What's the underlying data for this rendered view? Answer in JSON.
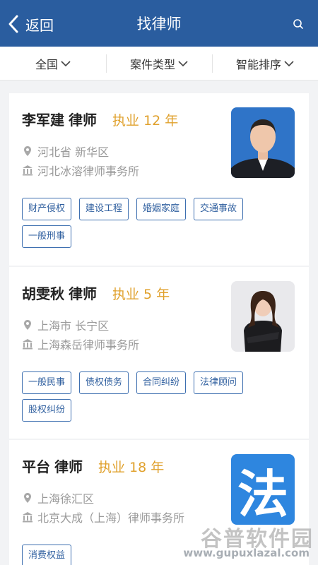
{
  "header": {
    "back_label": "返回",
    "title": "找律师",
    "search_icon": "search-icon"
  },
  "filters": [
    {
      "label": "全国"
    },
    {
      "label": "案件类型"
    },
    {
      "label": "智能排序"
    }
  ],
  "lawyers": [
    {
      "name": "李军建",
      "title": "律师",
      "years": "执业 12 年",
      "location": "河北省 新华区",
      "firm": "河北冰溶律师事务所",
      "tags": [
        "财产侵权",
        "建设工程",
        "婚姻家庭",
        "交通事故",
        "一般刑事"
      ]
    },
    {
      "name": "胡雯秋",
      "title": "律师",
      "years": "执业 5 年",
      "location": "上海市 长宁区",
      "firm": "上海森岳律师事务所",
      "tags": [
        "一般民事",
        "债权债务",
        "合同纠纷",
        "法律顾问",
        "股权纠纷"
      ]
    },
    {
      "name": "平台",
      "title": "律师",
      "years": "执业 18 年",
      "location": "上海徐汇区",
      "firm": "北京大成（上海）律师事务所",
      "tags": [
        "消费权益"
      ],
      "avatar_text": "法"
    }
  ],
  "watermark": {
    "main": "谷普软件园",
    "sub": "www.gupuxlazal.com"
  },
  "colors": {
    "header_bg": "#2a5d9f",
    "accent_years": "#e0a12d",
    "tag_border": "#3d6fb0"
  }
}
